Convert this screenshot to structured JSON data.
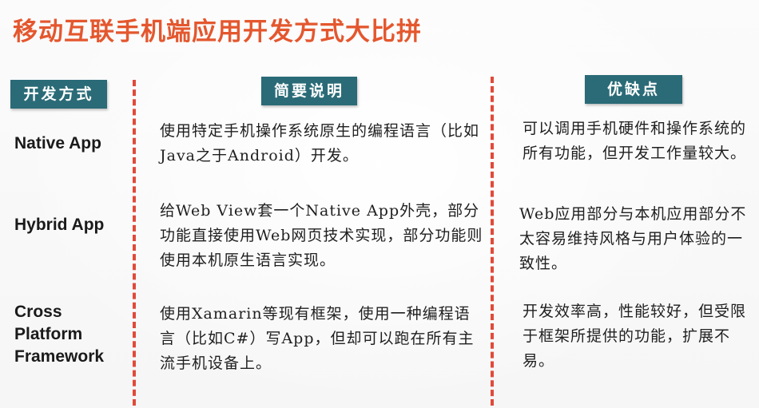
{
  "slide": {
    "title": "移动互联手机端应用开发方式大比拼"
  },
  "headers": {
    "method": "开发方式",
    "description": "简要说明",
    "pros_cons": "优缺点"
  },
  "rows": [
    {
      "label": "Native App",
      "description": "使用特定手机操作系统原生的编程语言（比如Java之于Android）开发。",
      "pros_cons": "可以调用手机硬件和操作系统的所有功能，但开发工作量较大。"
    },
    {
      "label": "Hybrid App",
      "description": "给Web View套一个Native App外壳，部分功能直接使用Web网页技术实现，部分功能则使用本机原生语言实现。",
      "pros_cons": "Web应用部分与本机应用部分不太容易维持风格与用户体验的一致性。"
    },
    {
      "label": "Cross Platform Framework",
      "description": "使用Xamarin等现有框架，使用一种编程语言（比如C#）写App，但却可以跑在所有主流手机设备上。",
      "pros_cons": "开发效率高，性能较好，但受限于框架所提供的功能，扩展不易。"
    }
  ],
  "colors": {
    "title": "#e4572e",
    "header_bg": "#2a6b77",
    "divider": "#e04a3a"
  }
}
